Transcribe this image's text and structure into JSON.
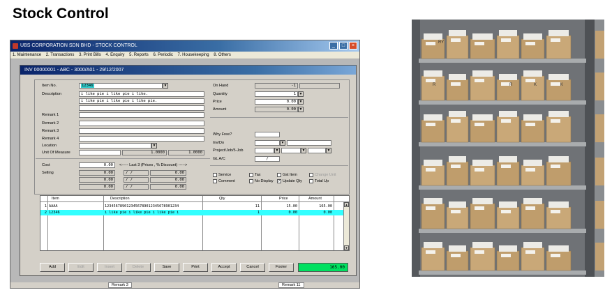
{
  "slide": {
    "title": "Stock Control"
  },
  "app": {
    "title": "UBS CORPORATION SDN BHD - STOCK CONTROL",
    "menu": [
      "1. Maintenance",
      "2. Transactions",
      "3. Print Bills",
      "4. Enquiry",
      "5. Reports",
      "6. Periodic",
      "7. Housekeeping",
      "8. Others"
    ]
  },
  "invoice": {
    "title": "INV 00000001 - ABC - 3000/A01 - 29/12/2007",
    "labels": {
      "item_no": "Item No.",
      "description": "Description",
      "remark1": "Remark 1",
      "remark2": "Remark 2",
      "remark3": "Remark 3",
      "remark4": "Remark 4",
      "location": "Location",
      "uom": "Unit Of Measure",
      "cost": "Cost",
      "selling": "Selling",
      "on_hand": "On Hand",
      "quantity": "Quantity",
      "price": "Price",
      "amount": "Amount",
      "why_free": "Why Free?",
      "inv_do": "Inv/Do",
      "project": "Project/Job/5-Job",
      "gl_ac": "GL A/C",
      "last3": "<----- Last 3 (Prices , % Discount) ----->"
    },
    "values": {
      "item_no": "12346",
      "description1": "i like pie i like pie i like.",
      "description2": "i like pie i like pie i like pie.",
      "uom_factor1": "1.0000",
      "uom_factor2": "1.0000",
      "on_hand": "-1",
      "quantity": "1",
      "price": "0.00",
      "amount": "0.00",
      "gl_ac": "/",
      "cost": "0.00",
      "selling_rows": [
        "0.00",
        "0.00",
        "0.00"
      ],
      "last3_dates": [
        "/ /",
        "/ /",
        "/ /",
        "/ /"
      ],
      "last3_vals": [
        "0.00",
        "0.00",
        "0.00",
        "0.00"
      ]
    },
    "checkboxes": [
      {
        "label": "Service",
        "checked": false,
        "disabled": false
      },
      {
        "label": "Tax",
        "checked": false,
        "disabled": false
      },
      {
        "label": "Gst Item",
        "checked": false,
        "disabled": false
      },
      {
        "label": "Change Unit",
        "checked": false,
        "disabled": true
      },
      {
        "label": "Comment",
        "checked": false,
        "disabled": false
      },
      {
        "label": "No Display",
        "checked": false,
        "disabled": false
      },
      {
        "label": "Update Qty",
        "checked": true,
        "disabled": false
      },
      {
        "label": "Total Up",
        "checked": false,
        "disabled": false
      }
    ],
    "grid": {
      "headers": [
        "Item",
        "Description",
        "Qty",
        "Price",
        "Amount"
      ],
      "rows": [
        {
          "num": "1",
          "item": "AAAA",
          "description": "1234567890123456789012345678901234",
          "qty": "11",
          "price": "15.00",
          "amount": "165.00"
        },
        {
          "num": "2",
          "item": "12346",
          "description": "i like pie i like pie i like pie i",
          "qty": "1",
          "price": "0.00",
          "amount": "0.00"
        }
      ]
    },
    "buttons": [
      "Add",
      "Edit",
      "Insert",
      "Delete",
      "Save",
      "Print",
      "Accept",
      "Cancel",
      "Footer"
    ],
    "total": "165.00",
    "footer_tabs": [
      "Remark 3",
      "Remark 11"
    ]
  },
  "photo": {
    "box_labels": [
      "RY",
      "R",
      "K",
      "R",
      "K"
    ]
  },
  "colors": {
    "selected_row": "#33ffff",
    "total_bg": "#00e060",
    "titlebar": "#0a246a"
  }
}
